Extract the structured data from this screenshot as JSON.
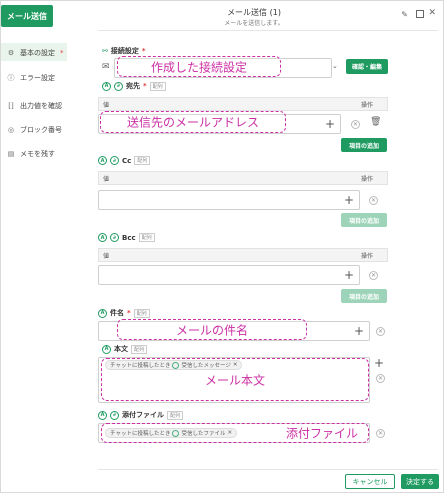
{
  "top_button": "メール送信",
  "header": {
    "title": "メール送信 (1)",
    "subtitle": "メールを送信します。"
  },
  "sidebar": {
    "items": [
      {
        "label": "基本の設定",
        "required": "*"
      },
      {
        "label": "エラー設定"
      },
      {
        "label": "出力値を確認"
      },
      {
        "label": "ブロック番号"
      },
      {
        "label": "メモを残す"
      }
    ]
  },
  "connection": {
    "label": "接続設定",
    "required": "*",
    "confirm_button": "確認・編集",
    "annotation": "作成した接続設定"
  },
  "from": {
    "label": "宛先",
    "required": "*",
    "col_value": "値",
    "col_action": "操作",
    "add_button": "項目の追加",
    "annotation": "送信先のメールアドレス"
  },
  "cc": {
    "label": "Cc",
    "col_value": "値",
    "col_action": "操作",
    "add_button": "項目の追加"
  },
  "bcc": {
    "label": "Bcc",
    "col_value": "値",
    "col_action": "操作",
    "add_button": "項目の追加"
  },
  "subject": {
    "label": "件名",
    "required": "*",
    "annotation": "メールの件名"
  },
  "body": {
    "label": "本文",
    "chip_1": "チャットに投稿したとき",
    "chip_2": "受信したメッセージ",
    "annotation": "メール本文"
  },
  "attachment": {
    "label": "添付ファイル",
    "chip_1": "チャットに投稿したとき",
    "chip_2": "受信したファイル",
    "annotation": "添付ファイル"
  },
  "footer": {
    "cancel": "キャンセル",
    "confirm": "決定する"
  },
  "colors": {
    "accent": "#1f9b61",
    "annotation": "#cc2fa3"
  }
}
